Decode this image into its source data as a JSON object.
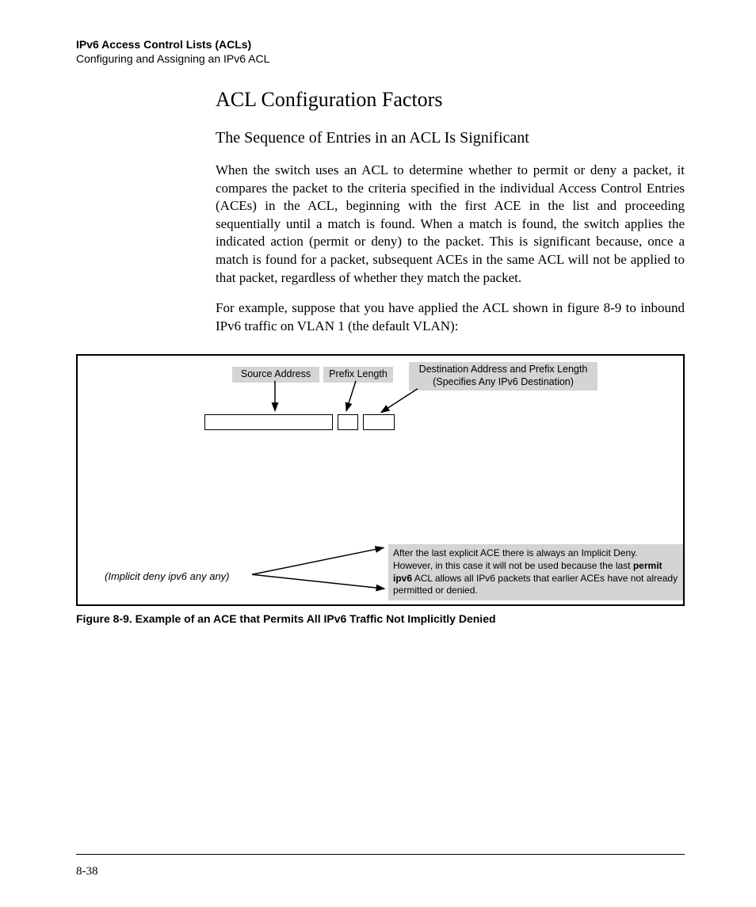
{
  "header": {
    "title": "IPv6 Access Control Lists (ACLs)",
    "subtitle": "Configuring and Assigning an IPv6 ACL"
  },
  "content": {
    "heading1": "ACL Configuration Factors",
    "heading2": "The Sequence of Entries in an ACL Is Significant",
    "para1": "When the switch uses an ACL to determine whether to permit or deny a packet, it compares the packet to the criteria specified in the individual Access Control Entries (ACEs) in the ACL, beginning with the first ACE in the list and proceeding sequentially until a match is found. When a match is found, the switch applies the indicated action (permit or deny) to the packet. This is significant because, once a match is found for a packet, subsequent ACEs in the same ACL will not be applied to that packet, regardless of whether they match the packet.",
    "para2": "For example, suppose that you have applied the ACL shown in figure 8-9 to inbound IPv6 traffic on VLAN 1 (the default VLAN):"
  },
  "figure": {
    "callouts": {
      "source": "Source Address",
      "prefix": "Prefix Length",
      "dest_line1": "Destination Address and Prefix Length",
      "dest_line2": "(Specifies Any IPv6 Destination)"
    },
    "implicit": "(Implicit deny ipv6 any any)",
    "afterlast_1": "After the last explicit ACE there is always an Implicit Deny. However, in this case it will not be used because the last ",
    "afterlast_bold": "permit ipv6",
    "afterlast_2": " ACL allows all IPv6 packets that earlier ACEs have not already permitted or denied.",
    "caption": "Figure 8-9. Example of an ACE that Permits All IPv6 Traffic Not Implicitly Denied"
  },
  "pagenum": "8-38"
}
